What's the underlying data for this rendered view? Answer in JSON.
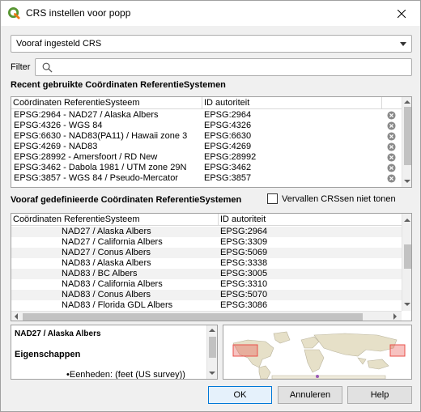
{
  "window": {
    "title": "CRS instellen voor popp"
  },
  "preset": {
    "value": "Vooraf ingesteld CRS"
  },
  "filter": {
    "label": "Filter",
    "value": "",
    "placeholder": ""
  },
  "recent": {
    "title": "Recent gebruikte Coördinaten ReferentieSystemen",
    "columns": [
      "Coördinaten ReferentieSysteem",
      "ID autoriteit"
    ],
    "rows": [
      [
        "EPSG:2964 - NAD27 / Alaska Albers",
        "EPSG:2964"
      ],
      [
        "EPSG:4326 - WGS 84",
        "EPSG:4326"
      ],
      [
        "EPSG:6630 - NAD83(PA11) / Hawaii zone 3",
        "EPSG:6630"
      ],
      [
        "EPSG:4269 - NAD83",
        "EPSG:4269"
      ],
      [
        "EPSG:28992 - Amersfoort / RD New",
        "EPSG:28992"
      ],
      [
        "EPSG:3462 - Dabola 1981 / UTM zone 29N",
        "EPSG:3462"
      ],
      [
        "EPSG:3857 - WGS 84 / Pseudo-Mercator",
        "EPSG:3857"
      ]
    ]
  },
  "predefined": {
    "title": "Vooraf gedefinieerde Coördinaten ReferentieSystemen",
    "hide_deprecated_label": "Vervallen CRSsen niet tonen",
    "hide_deprecated_checked": false,
    "columns": [
      "Coördinaten ReferentieSysteem",
      "ID autoriteit"
    ],
    "rows": [
      [
        "NAD27 / Alaska Albers",
        "EPSG:2964"
      ],
      [
        "NAD27 / California Albers",
        "EPSG:3309"
      ],
      [
        "NAD27 / Conus Albers",
        "EPSG:5069"
      ],
      [
        "NAD83 / Alaska Albers",
        "EPSG:3338"
      ],
      [
        "NAD83 / BC Albers",
        "EPSG:3005"
      ],
      [
        "NAD83 / California Albers",
        "EPSG:3310"
      ],
      [
        "NAD83 / Conus Albers",
        "EPSG:5070"
      ],
      [
        "NAD83 / Florida GDL Albers",
        "EPSG:3086"
      ]
    ]
  },
  "info": {
    "title": "NAD27 / Alaska Albers",
    "properties_heading": "Eigenschappen",
    "bullet": "•Eenheden: (feet (US survey))"
  },
  "buttons": {
    "ok": "OK",
    "cancel": "Annuleren",
    "help": "Help"
  },
  "colors": {
    "qgis_green": "#589632",
    "qgis_yellow": "#ee7913",
    "extent_red": "#e8504a",
    "map_land": "#e6e0c8",
    "selection": "#0078d7"
  }
}
